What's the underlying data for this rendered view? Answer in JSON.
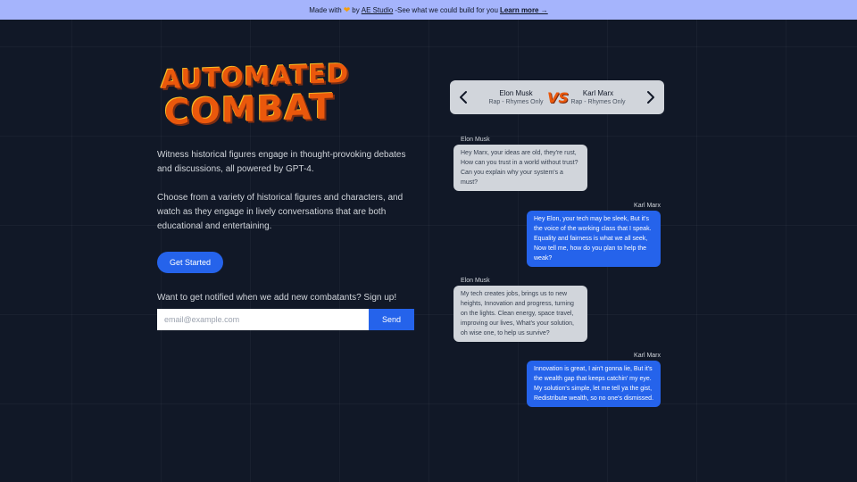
{
  "banner": {
    "made_with": "Made with",
    "by": "by",
    "studio": "AE Studio",
    "tagline": "-See what we could build for you",
    "learn_more": "Learn more →"
  },
  "hero": {
    "logo_line1": "AUTOMATED",
    "logo_line2": "COMBAT",
    "paragraph1": "Witness historical figures engage in thought-provoking debates and discussions, all powered by GPT-4.",
    "paragraph2": "Choose from a variety of historical figures and characters, and watch as they engage in lively conversations that are both educational and entertaining.",
    "get_started": "Get Started",
    "notify_text": "Want to get notified when we add new combatants? Sign up!",
    "email_placeholder": "email@example.com",
    "email_value": "",
    "send_label": "Send"
  },
  "selector": {
    "left_name": "Elon Musk",
    "left_mode": "Rap - Rhymes Only",
    "vs": "VS",
    "right_name": "Karl Marx",
    "right_mode": "Rap - Rhymes Only"
  },
  "messages": [
    {
      "speaker": "Elon Musk",
      "side": "left",
      "text": "Hey Marx, your ideas are old, they're rust, How can you trust in a world without trust? Can you explain why your system's a must?"
    },
    {
      "speaker": "Karl Marx",
      "side": "right",
      "text": "Hey Elon, your tech may be sleek, But it's the voice of the working class that I speak. Equality and fairness is what we all seek, Now tell me, how do you plan to help the weak?"
    },
    {
      "speaker": "Elon Musk",
      "side": "left",
      "text": "My tech creates jobs, brings us to new heights, Innovation and progress, turning on the lights. Clean energy, space travel, improving our lives, What's your solution, oh wise one, to help us survive?"
    },
    {
      "speaker": "Karl Marx",
      "side": "right",
      "text": "Innovation is great, I ain't gonna lie, But it's the wealth gap that keeps catchin' my eye. My solution's simple, let me tell ya the gist, Redistribute wealth, so no one's dismissed."
    }
  ],
  "colors": {
    "background": "#111827",
    "banner": "#a5b4fc",
    "accent": "#2563eb",
    "logo": "#ea580c"
  }
}
